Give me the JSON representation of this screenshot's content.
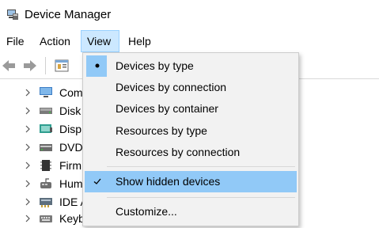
{
  "window": {
    "title": "Device Manager",
    "icon": "device-manager-icon"
  },
  "menubar": {
    "items": [
      {
        "label": "File"
      },
      {
        "label": "Action"
      },
      {
        "label": "View"
      },
      {
        "label": "Help"
      }
    ],
    "active": "View"
  },
  "toolbar": {
    "buttons": [
      "back-arrow-icon",
      "forward-arrow-icon",
      "properties-icon"
    ]
  },
  "tree": {
    "items": [
      {
        "label": "Com",
        "icon": "computer-icon"
      },
      {
        "label": "Disk",
        "icon": "disk-drive-icon"
      },
      {
        "label": "Disp",
        "icon": "display-adapter-icon"
      },
      {
        "label": "DVD",
        "icon": "dvd-drive-icon"
      },
      {
        "label": "Firm",
        "icon": "firmware-icon"
      },
      {
        "label": "Hum",
        "icon": "hid-icon"
      },
      {
        "label": "IDE A",
        "icon": "ide-controller-icon"
      },
      {
        "label": "Keyb",
        "icon": "keyboard-icon"
      }
    ]
  },
  "view_menu": {
    "items": [
      {
        "label": "Devices by type",
        "mark": "bullet",
        "checked": true
      },
      {
        "label": "Devices by connection",
        "checked": false
      },
      {
        "label": "Devices by container",
        "checked": false
      },
      {
        "label": "Resources by type",
        "checked": false
      },
      {
        "label": "Resources by connection",
        "checked": false
      },
      {
        "label": "Show hidden devices",
        "mark": "checkmark",
        "checked": true
      },
      {
        "label": "Customize...",
        "checked": false
      }
    ]
  },
  "colors": {
    "menu_active_bg": "#cce8ff",
    "dropdown_bg": "#f2f2f2",
    "highlight": "#91c9f7"
  }
}
